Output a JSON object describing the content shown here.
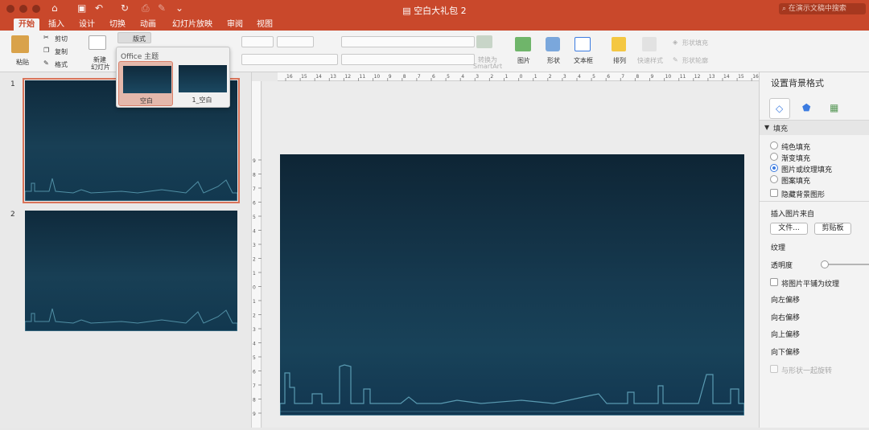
{
  "app": {
    "doc_title": "空白大礼包 2",
    "search_placeholder": "在演示文稿中搜索"
  },
  "tabs": [
    "开始",
    "插入",
    "设计",
    "切换",
    "动画",
    "幻灯片放映",
    "审阅",
    "视图"
  ],
  "ribbon": {
    "paste": "粘贴",
    "cut": "剪切",
    "copy": "复制",
    "format": "格式",
    "new_slide_1": "新建",
    "new_slide_2": "幻灯片",
    "layout": "版式",
    "convert_1": "转换为",
    "convert_2": "SmartArt",
    "picture": "图片",
    "shape": "形状",
    "textbox": "文本框",
    "arrange": "排列",
    "quick_styles": "快速样式",
    "shape_fill": "形状填充",
    "shape_outline": "形状轮廓"
  },
  "layout_popup": {
    "title": "Office 主题",
    "items": [
      "空白",
      "1_空白"
    ]
  },
  "slides": [
    "1",
    "2"
  ],
  "format_pane": {
    "title": "设置背景格式",
    "fill_section": "填充",
    "fill_options": [
      "纯色填充",
      "渐变填充",
      "图片或纹理填充",
      "图案填充"
    ],
    "selected_fill": "图片或纹理填充",
    "hide_bg": "隐藏背景图形",
    "insert_from": "插入图片来自",
    "file_btn": "文件...",
    "clipboard_btn": "剪贴板",
    "texture": "纹理",
    "transparency": "透明度",
    "transparency_value": 0,
    "tile": "将图片平铺为纹理",
    "offset_left": "向左偏移",
    "offset_right": "向右偏移",
    "offset_up": "向上偏移",
    "offset_down": "向下偏移",
    "rotate_with_shape": "与形状一起旋转"
  },
  "ruler": {
    "top_ticks": [
      "16",
      "15",
      "14",
      "13",
      "12",
      "11",
      "10",
      "9",
      "8",
      "7",
      "6",
      "5",
      "4",
      "3",
      "2",
      "1",
      "0",
      "1",
      "2",
      "3",
      "4",
      "5",
      "6",
      "7",
      "8",
      "9",
      "10",
      "11",
      "12",
      "13",
      "14",
      "15",
      "16"
    ],
    "left_ticks": [
      "9",
      "8",
      "7",
      "6",
      "5",
      "4",
      "3",
      "2",
      "1",
      "0",
      "1",
      "2",
      "3",
      "4",
      "5",
      "6",
      "7",
      "8",
      "9"
    ]
  },
  "colors": {
    "accent": "#c9482b",
    "slide_bg": "#163a50",
    "skyline": "#6bb3c9",
    "selection": "#d9745a",
    "radio_on": "#3b7be0"
  }
}
